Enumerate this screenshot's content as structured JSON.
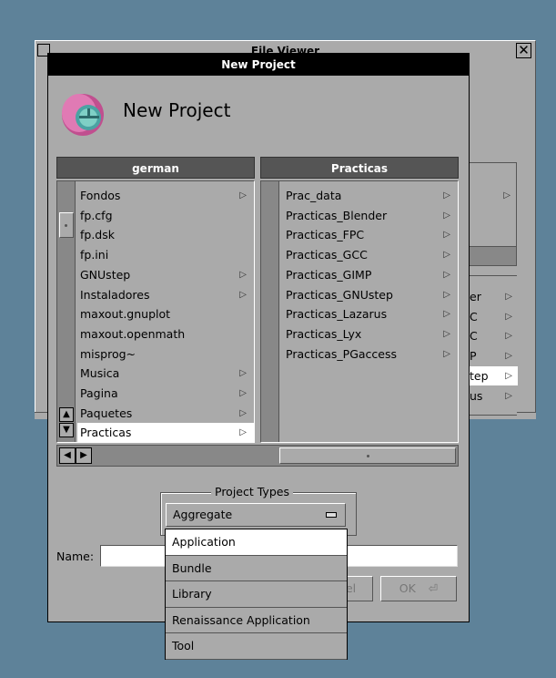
{
  "file_viewer": {
    "title": "File Viewer",
    "partial_items": [
      {
        "text": "er",
        "sel": false
      },
      {
        "text": "C",
        "sel": false
      },
      {
        "text": "C",
        "sel": false
      },
      {
        "text": "P",
        "sel": false
      },
      {
        "text": "tep",
        "sel": true
      },
      {
        "text": "us",
        "sel": false
      }
    ]
  },
  "new_project": {
    "window_title": "New Project",
    "heading": "New Project",
    "left_column": {
      "header": "german",
      "items": [
        {
          "label": "Fondos",
          "has_children": true,
          "selected": false
        },
        {
          "label": "fp.cfg",
          "has_children": false,
          "selected": false
        },
        {
          "label": "fp.dsk",
          "has_children": false,
          "selected": false
        },
        {
          "label": "fp.ini",
          "has_children": false,
          "selected": false
        },
        {
          "label": "GNUstep",
          "has_children": true,
          "selected": false
        },
        {
          "label": "Instaladores",
          "has_children": true,
          "selected": false
        },
        {
          "label": "maxout.gnuplot",
          "has_children": false,
          "selected": false
        },
        {
          "label": "maxout.openmath",
          "has_children": false,
          "selected": false
        },
        {
          "label": "misprog~",
          "has_children": false,
          "selected": false
        },
        {
          "label": "Musica",
          "has_children": true,
          "selected": false
        },
        {
          "label": "Pagina",
          "has_children": true,
          "selected": false
        },
        {
          "label": "Paquetes",
          "has_children": true,
          "selected": false
        },
        {
          "label": "Practicas",
          "has_children": true,
          "selected": true
        }
      ]
    },
    "right_column": {
      "header": "Practicas",
      "items": [
        {
          "label": "Prac_data",
          "has_children": true
        },
        {
          "label": "Practicas_Blender",
          "has_children": true
        },
        {
          "label": "Practicas_FPC",
          "has_children": true
        },
        {
          "label": "Practicas_GCC",
          "has_children": true
        },
        {
          "label": "Practicas_GIMP",
          "has_children": true
        },
        {
          "label": "Practicas_GNUstep",
          "has_children": true
        },
        {
          "label": "Practicas_Lazarus",
          "has_children": true
        },
        {
          "label": "Practicas_Lyx",
          "has_children": true
        },
        {
          "label": "Practicas_PGaccess",
          "has_children": true
        }
      ]
    },
    "project_types": {
      "legend": "Project Types",
      "selected": "Aggregate",
      "options": [
        "Application",
        "Bundle",
        "Library",
        "Renaissance Application",
        "Tool"
      ],
      "highlighted": "Application"
    },
    "name_label": "Name:",
    "name_value": "",
    "cancel_label": "Cancel",
    "ok_label": "OK"
  }
}
